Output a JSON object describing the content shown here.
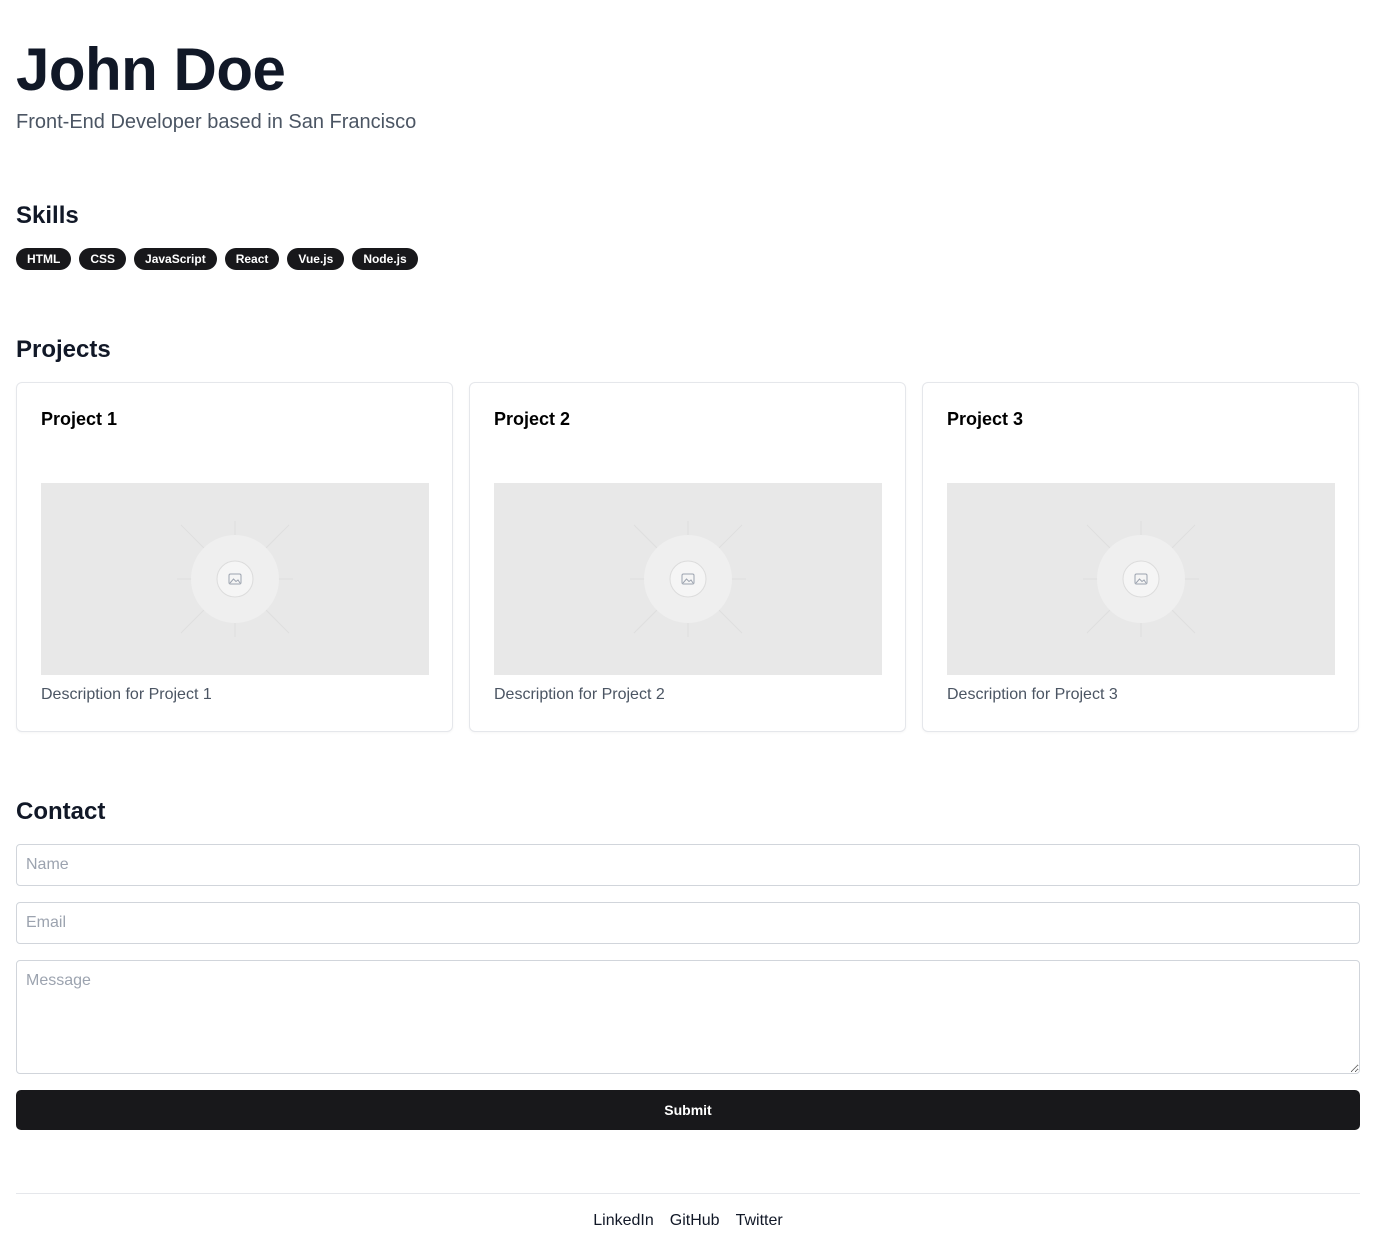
{
  "header": {
    "name": "John Doe",
    "tagline": "Front-End Developer based in San Francisco"
  },
  "skills": {
    "heading": "Skills",
    "items": [
      "HTML",
      "CSS",
      "JavaScript",
      "React",
      "Vue.js",
      "Node.js"
    ]
  },
  "projects": {
    "heading": "Projects",
    "items": [
      {
        "title": "Project 1",
        "description": "Description for Project 1",
        "image_icon": "image-placeholder-icon"
      },
      {
        "title": "Project 2",
        "description": "Description for Project 2",
        "image_icon": "image-placeholder-icon"
      },
      {
        "title": "Project 3",
        "description": "Description for Project 3",
        "image_icon": "image-placeholder-icon"
      }
    ]
  },
  "contact": {
    "heading": "Contact",
    "name_placeholder": "Name",
    "name_value": "",
    "email_placeholder": "Email",
    "email_value": "",
    "message_placeholder": "Message",
    "message_value": "",
    "submit_label": "Submit"
  },
  "footer": {
    "links": [
      "LinkedIn",
      "GitHub",
      "Twitter"
    ]
  },
  "colors": {
    "text": "#111827",
    "muted": "#4b5563",
    "accent": "#18181b",
    "border": "#e5e7eb",
    "image_placeholder": "#e8e8e8"
  }
}
